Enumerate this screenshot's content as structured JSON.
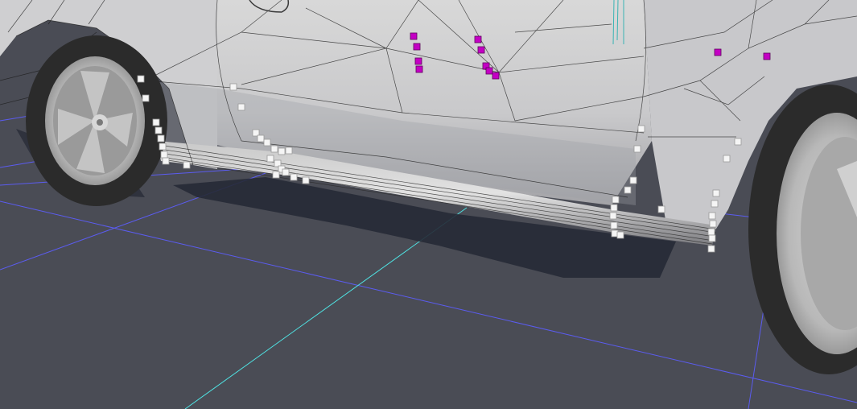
{
  "viewport": {
    "mode": "mesh-edit",
    "display": "wireframe-on-shaded",
    "colors": {
      "background": "#4a4c55",
      "grid_line": "#5b5cf0",
      "axis_line": "#4fe3e3",
      "body_light": "#e6e6e6",
      "body_dark": "#8f9096",
      "wire": "#1c1c1c",
      "vertex_selected": "#f5f5f5",
      "vertex_magenta": "#c400c4",
      "tire": "#2b2b2b",
      "rim": "#bdbdbd",
      "shadow": "#262a36"
    }
  },
  "model": {
    "object": "car-body",
    "parts": [
      "left-side-skirt",
      "front-wheel",
      "rear-wheel",
      "door",
      "front-fender",
      "rear-quarter-panel"
    ]
  },
  "selection": {
    "element_type": "vertex",
    "highlighted_groups": [
      "skirt-front-end",
      "skirt-front-door-seam",
      "skirt-rear-door-seam",
      "skirt-rear-end"
    ],
    "secondary_marker_groups": [
      "door-markers-left",
      "door-markers-right",
      "quarter-panel-markers"
    ]
  }
}
